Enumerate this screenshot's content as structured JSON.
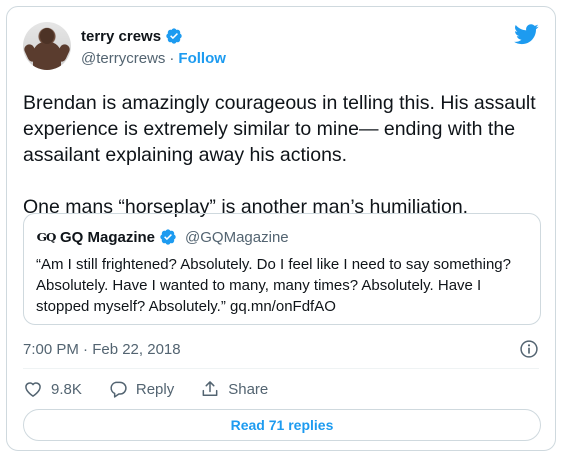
{
  "author": {
    "display_name": "terry crews",
    "handle": "@terrycrews",
    "separator": "·",
    "follow_label": "Follow"
  },
  "tweet": {
    "text": "Brendan is amazingly courageous in telling this. His assault experience is extremely similar to mine— ending with the assailant explaining away his actions.\n\nOne mans “horseplay” is another man’s humiliation."
  },
  "quote": {
    "logo_text": "GQ",
    "display_name": "GQ Magazine",
    "handle": "@GQMagazine",
    "text": "“Am I still frightened? Absolutely. Do I feel like I need to say something? Absolutely. Have I wanted to many, many times? Absolutely. Have I stopped myself? Absolutely.” gq.mn/onFdfAO"
  },
  "meta": {
    "timestamp": "7:00 PM · Feb 22, 2018"
  },
  "actions": {
    "like_count": "9.8K",
    "reply_label": "Reply",
    "share_label": "Share"
  },
  "read_replies_label": "Read 71 replies",
  "colors": {
    "accent": "#1d9bf0",
    "text": "#0f1419",
    "secondary": "#536471",
    "border": "#cfd9de"
  },
  "icons": [
    "verified-badge-icon",
    "twitter-bird-icon",
    "info-icon",
    "heart-icon",
    "reply-bubble-icon",
    "share-icon"
  ]
}
